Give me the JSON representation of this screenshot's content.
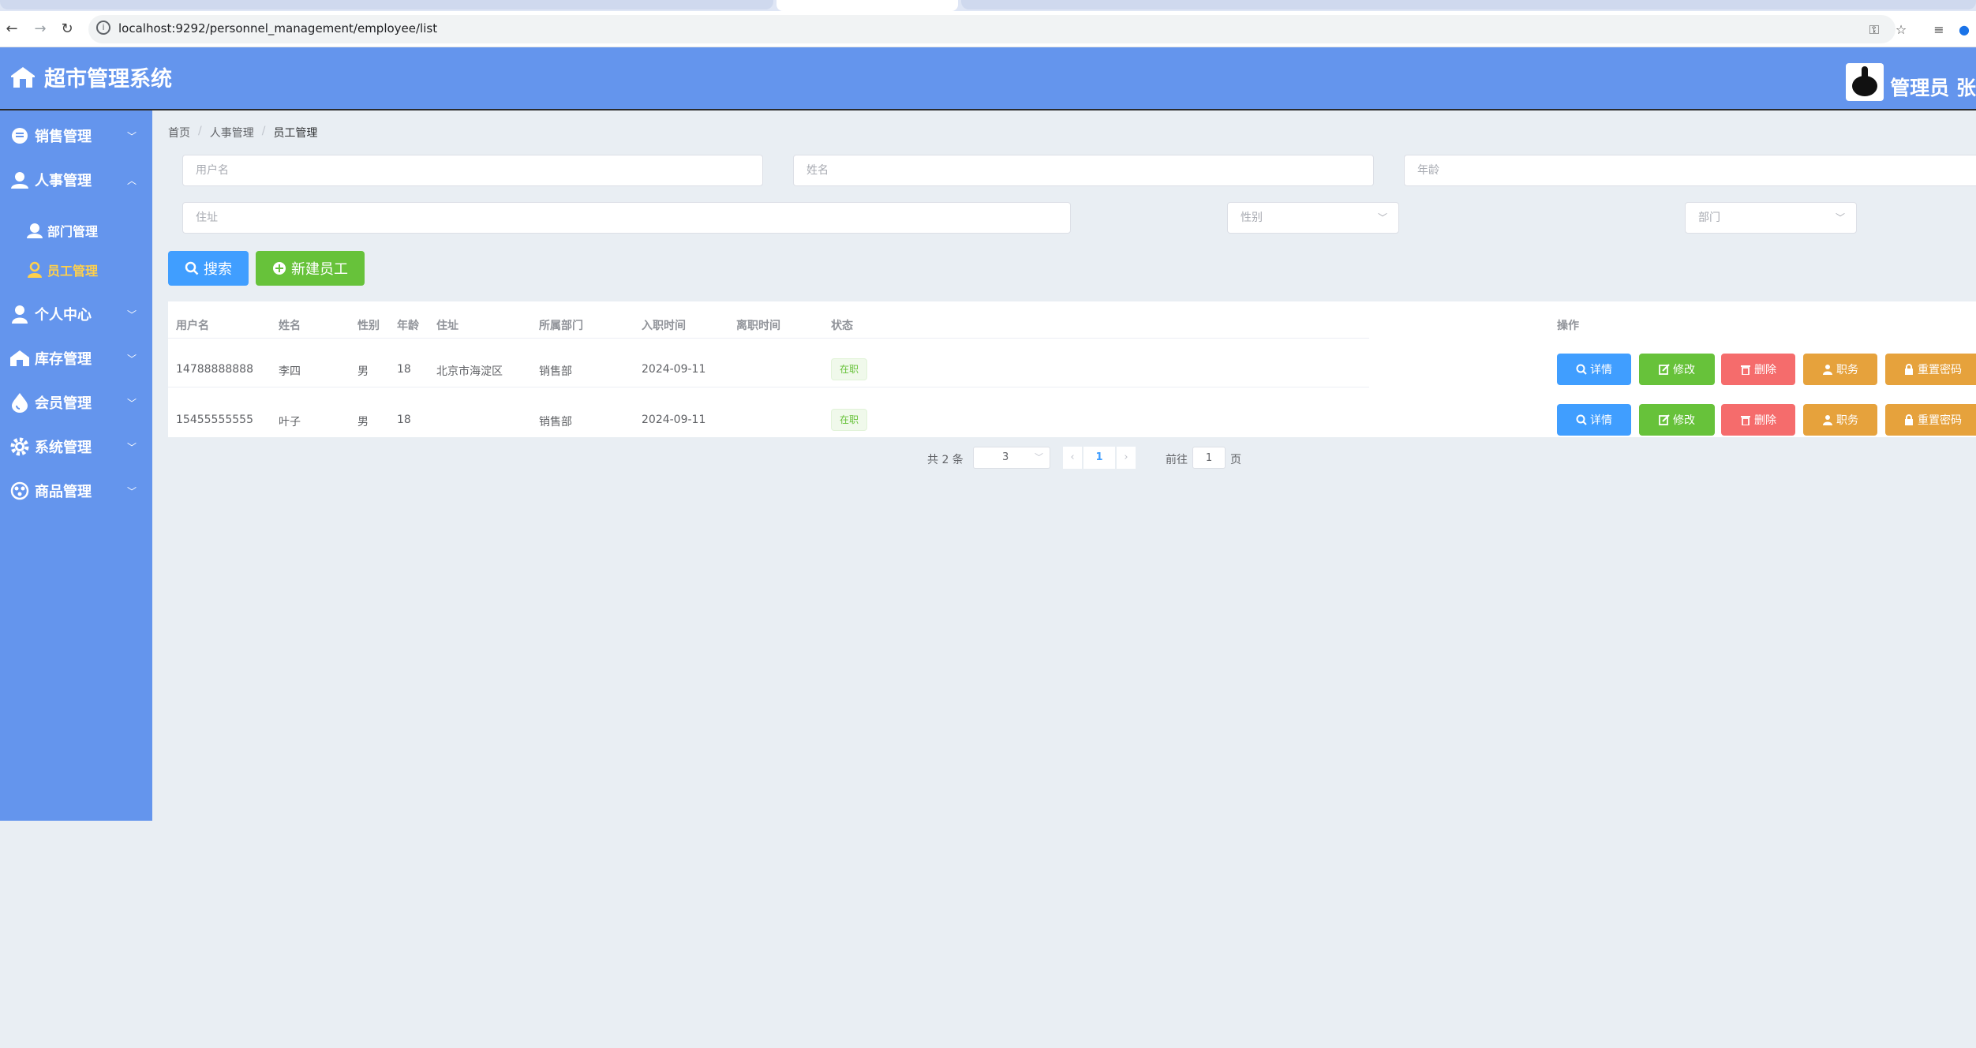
{
  "browser": {
    "url": "localhost:9292/personnel_management/employee/list"
  },
  "header": {
    "app_title": "超市管理系统",
    "admin_label": "管理员 张"
  },
  "sidebar": {
    "items": [
      {
        "label": "销售管理",
        "icon": "tag-icon",
        "expanded": false
      },
      {
        "label": "人事管理",
        "icon": "users-icon",
        "expanded": true
      },
      {
        "label": "个人中心",
        "icon": "user-icon",
        "expanded": false
      },
      {
        "label": "库存管理",
        "icon": "warehouse-icon",
        "expanded": false
      },
      {
        "label": "会员管理",
        "icon": "drop-icon",
        "expanded": false
      },
      {
        "label": "系统管理",
        "icon": "gear-icon",
        "expanded": false
      },
      {
        "label": "商品管理",
        "icon": "goods-icon",
        "expanded": false
      }
    ],
    "submenu": [
      {
        "label": "部门管理",
        "icon": "department-icon",
        "active": false
      },
      {
        "label": "员工管理",
        "icon": "employee-icon",
        "active": true
      }
    ]
  },
  "breadcrumb": [
    "首页",
    "人事管理",
    "员工管理"
  ],
  "filters": {
    "username_placeholder": "用户名",
    "name_placeholder": "姓名",
    "age_placeholder": "年龄",
    "address_placeholder": "住址",
    "gender_placeholder": "性别",
    "department_placeholder": "部门"
  },
  "actions": {
    "search_label": "搜索",
    "new_label": "新建员工"
  },
  "table": {
    "columns": [
      "用户名",
      "姓名",
      "性别",
      "年龄",
      "住址",
      "所属部门",
      "入职时间",
      "离职时间",
      "状态",
      "操作"
    ],
    "rows": [
      {
        "username": "14788888888",
        "name": "李四",
        "gender": "男",
        "age": "18",
        "address": "北京市海淀区",
        "department": "销售部",
        "hire_date": "2024-09-11",
        "leave_date": "",
        "status": "在职"
      },
      {
        "username": "15455555555",
        "name": "叶子",
        "gender": "男",
        "age": "18",
        "address": "",
        "department": "销售部",
        "hire_date": "2024-09-11",
        "leave_date": "",
        "status": "在职"
      }
    ],
    "op_labels": {
      "detail": "详情",
      "edit": "修改",
      "delete": "删除",
      "duty": "职务",
      "reset": "重置密码"
    }
  },
  "pagination": {
    "total_label": "共 2 条",
    "page_size": "3",
    "current_page": "1",
    "goto_label": "前往",
    "goto_value": "1",
    "page_suffix": "页"
  },
  "colors": {
    "primary_blue": "#6495ed",
    "button_blue": "#409eff",
    "button_green": "#67c23a",
    "button_red": "#f56c6c",
    "button_orange": "#e6a23c",
    "active_menu": "#ffd04b"
  }
}
